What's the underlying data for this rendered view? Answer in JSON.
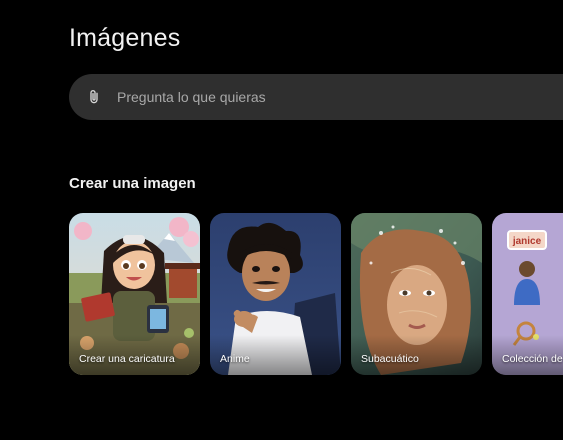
{
  "header": {
    "title": "Imágenes"
  },
  "search": {
    "placeholder": "Pregunta lo que quieras",
    "attach_icon": "paperclip-icon"
  },
  "section": {
    "title": "Crear una imagen"
  },
  "cards": [
    {
      "label": "Crear una caricatura",
      "thumbnail": "caricature-girl-thumbnail"
    },
    {
      "label": "Anime",
      "thumbnail": "anime-man-thumbnail"
    },
    {
      "label": "Subacuático",
      "thumbnail": "underwater-woman-thumbnail"
    },
    {
      "label": "Colección de",
      "thumbnail": "sticker-collection-thumbnail",
      "sticker_text": "janice"
    }
  ],
  "colors": {
    "background": "#000000",
    "search_bar": "#2f2f2f",
    "placeholder": "#a8a8a8",
    "text": "#f2f2f2"
  }
}
